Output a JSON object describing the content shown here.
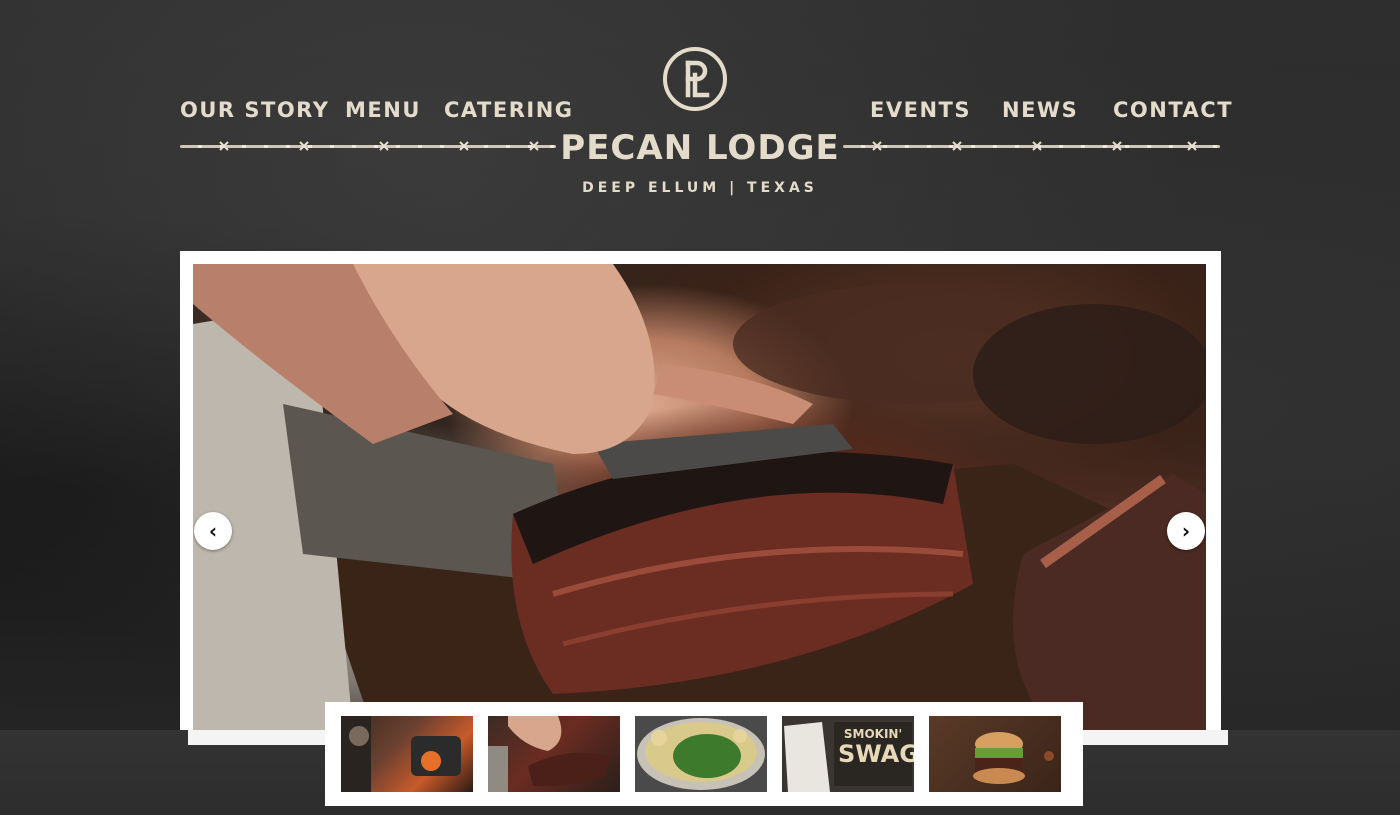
{
  "nav": {
    "left": [
      {
        "label": "OUR STORY"
      },
      {
        "label": "MENU"
      },
      {
        "label": "CATERING"
      }
    ],
    "right": [
      {
        "label": "EVENTS"
      },
      {
        "label": "NEWS"
      },
      {
        "label": "CONTACT"
      }
    ]
  },
  "brand": {
    "name": "PECAN LODGE",
    "tagline": "DEEP ELLUM | TEXAS",
    "monogram": "PL"
  },
  "hero": {
    "image": "brisket-being-sliced",
    "prev_icon": "chevron-left-icon",
    "next_icon": "chevron-right-icon",
    "prev_glyph": "‹",
    "next_glyph": "›"
  },
  "thumbnails": [
    {
      "image": "pitmaster-at-smoker"
    },
    {
      "image": "brisket-slicing"
    },
    {
      "image": "pot-of-greens"
    },
    {
      "image": "smokin-swag-merch",
      "label_line1": "SMOKIN'",
      "label_line2": "SWAG"
    },
    {
      "image": "pulled-pork-sandwich"
    }
  ],
  "colors": {
    "background": "#2b2b2b",
    "accent_text": "#e4dccb",
    "frame": "#ffffff"
  }
}
